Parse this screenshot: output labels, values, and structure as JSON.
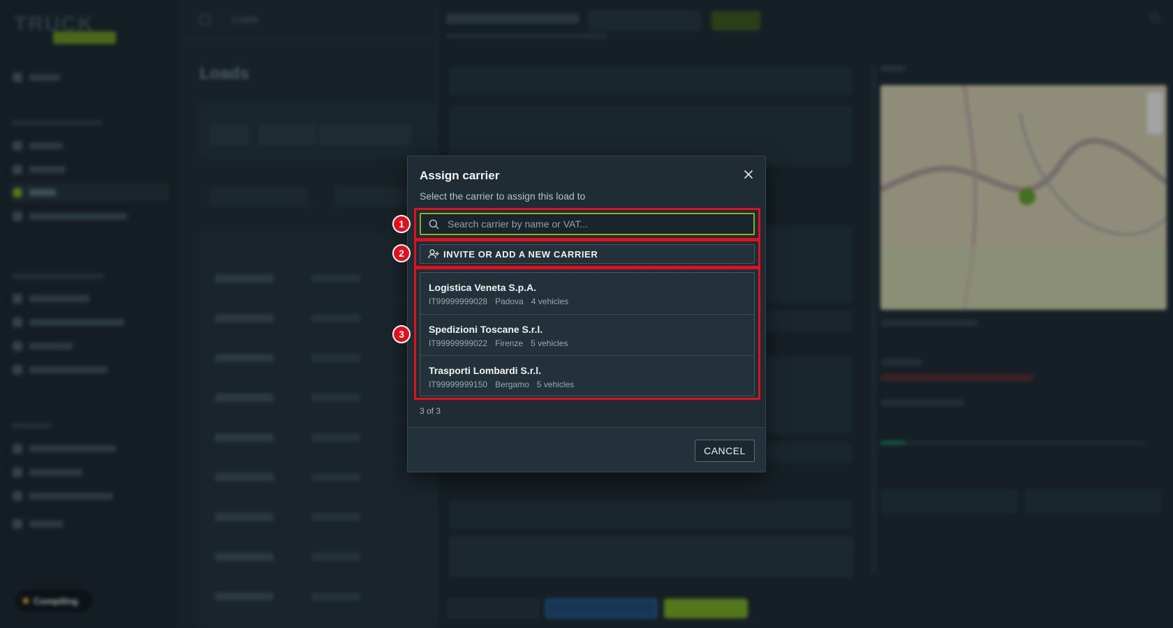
{
  "background": {
    "logo": "TRUCK",
    "compiling": "Compiling",
    "page_title": "Loads",
    "breadcrumb": "Loads"
  },
  "dialog": {
    "title": "Assign carrier",
    "subtitle": "Select the carrier to assign this load to",
    "search_placeholder": "Search carrier by name or VAT...",
    "invite_label": "INVITE OR ADD A NEW CARRIER",
    "carriers": [
      {
        "name": "Logistica Veneta S.p.A.",
        "vat": "IT99999999028",
        "city": "Padova",
        "vehicles": "4 vehicles"
      },
      {
        "name": "Spedizioni Toscane S.r.l.",
        "vat": "IT99999999022",
        "city": "Firenze",
        "vehicles": "5 vehicles"
      },
      {
        "name": "Trasporti Lombardi S.r.l.",
        "vat": "IT99999999150",
        "city": "Bergamo",
        "vehicles": "5 vehicles"
      }
    ],
    "count_text": "3 of 3",
    "cancel_label": "CANCEL"
  },
  "annotations": [
    {
      "number": "1"
    },
    {
      "number": "2"
    },
    {
      "number": "3"
    }
  ],
  "colors": {
    "accent": "#86b31f",
    "highlight": "#e0101c",
    "dialog_bg": "#1f2c33"
  }
}
